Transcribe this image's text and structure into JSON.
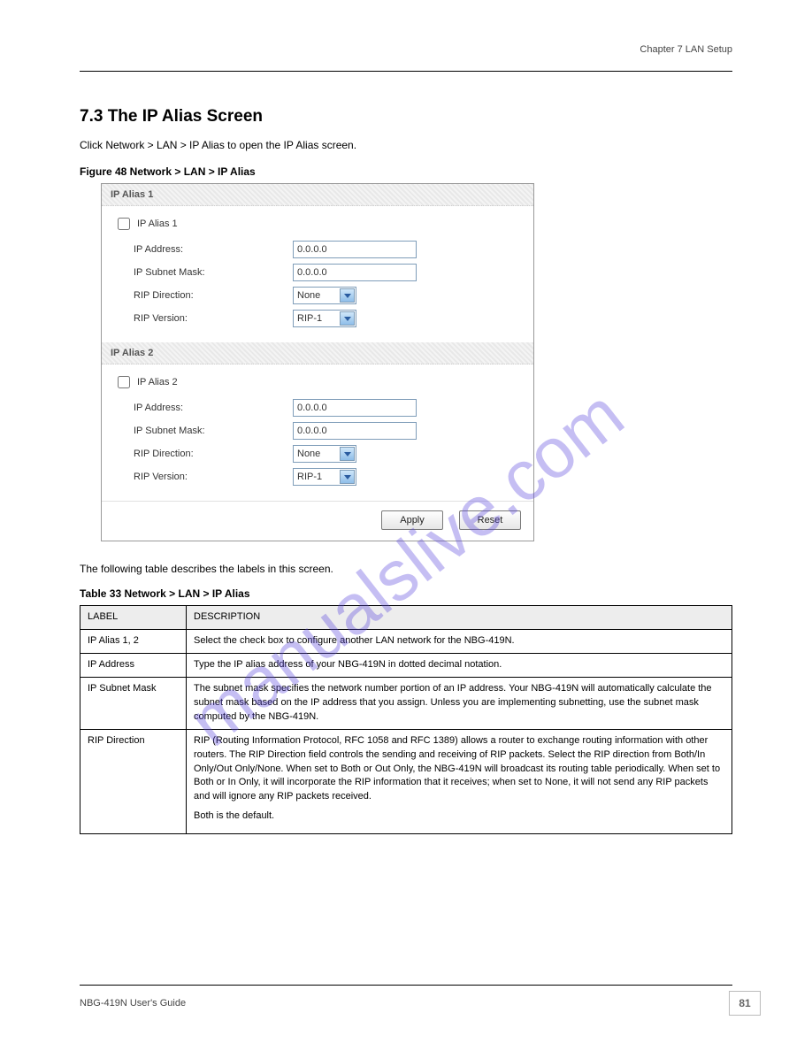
{
  "chapter_line": "Chapter 7 LAN Setup",
  "heading": "7.3  The IP Alias Screen",
  "intro": "Click Network > LAN > IP Alias to open the IP Alias screen.",
  "fig_caption": "Figure 48   Network > LAN > IP Alias",
  "watermark": "manualslive.com",
  "panel": {
    "alias1": {
      "title": "IP Alias 1",
      "check_label": "IP Alias 1",
      "ip_label": "IP Address:",
      "ip_value": "0.0.0.0",
      "mask_label": "IP Subnet Mask:",
      "mask_value": "0.0.0.0",
      "ripd_label": "RIP Direction:",
      "ripd_value": "None",
      "ripv_label": "RIP Version:",
      "ripv_value": "RIP-1"
    },
    "alias2": {
      "title": "IP Alias 2",
      "check_label": "IP Alias 2",
      "ip_label": "IP Address:",
      "ip_value": "0.0.0.0",
      "mask_label": "IP Subnet Mask:",
      "mask_value": "0.0.0.0",
      "ripd_label": "RIP Direction:",
      "ripd_value": "None",
      "ripv_label": "RIP Version:",
      "ripv_value": "RIP-1"
    },
    "apply": "Apply",
    "reset": "Reset"
  },
  "post_intro": "The following table describes the labels in this screen.",
  "tab_caption": "Table 33   Network > LAN > IP Alias",
  "table": {
    "head_label": "LABEL",
    "head_desc": "DESCRIPTION",
    "rows": [
      {
        "label": "IP Alias 1, 2",
        "desc": "Select the check box to configure another LAN network for the NBG-419N."
      },
      {
        "label": "IP Address",
        "desc": "Type the IP alias address of your NBG-419N in dotted decimal notation."
      },
      {
        "label": "IP Subnet Mask",
        "desc": "The subnet mask specifies the network number portion of an IP address. Your NBG-419N will automatically calculate the subnet mask based on the IP address that you assign. Unless you are implementing subnetting, use the subnet mask computed by the NBG-419N."
      },
      {
        "label": "RIP Direction",
        "desc_parts": [
          "RIP (Routing Information Protocol, RFC 1058 and RFC 1389) allows a router to exchange routing information with other routers. The RIP Direction field controls the sending and receiving of RIP packets. Select the RIP direction from Both/In Only/Out Only/None. When set to Both or Out Only, the NBG-419N will broadcast its routing table periodically. When set to Both or In Only, it will incorporate the RIP information that it receives; when set to None, it will not send any RIP packets and will ignore any RIP packets received.",
          "Both is the default."
        ]
      }
    ]
  },
  "footer_left": "NBG-419N User's Guide",
  "page_number": "81"
}
